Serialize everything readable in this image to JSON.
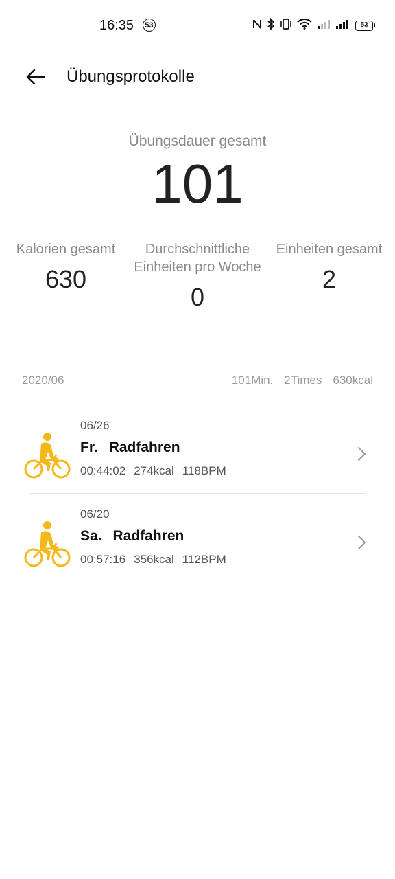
{
  "status_bar": {
    "time": "16:35",
    "badge": "53",
    "battery": "53",
    "icons": [
      "nfc-icon",
      "bluetooth-icon",
      "vibrate-icon",
      "wifi-icon",
      "signal-icon",
      "signal-icon"
    ]
  },
  "header": {
    "title": "Übungsprotokolle"
  },
  "summary": {
    "duration_label": "Übungsdauer gesamt",
    "duration_value": "101"
  },
  "stats": {
    "calories_label": "Kalorien gesamt",
    "calories_value": "630",
    "weekly_label": "Durchschnittliche Einheiten pro Woche",
    "weekly_value": "0",
    "units_label": "Einheiten gesamt",
    "units_value": "2"
  },
  "month": {
    "label": "2020/06",
    "minutes": "101Min.",
    "times": "2Times",
    "kcal": "630kcal"
  },
  "activities": [
    {
      "date": "06/26",
      "day": "Fr.",
      "type": "Radfahren",
      "duration": "00:44:02",
      "kcal": "274kcal",
      "bpm": "118BPM"
    },
    {
      "date": "06/20",
      "day": "Sa.",
      "type": "Radfahren",
      "duration": "00:57:16",
      "kcal": "356kcal",
      "bpm": "112BPM"
    }
  ],
  "colors": {
    "accent": "#F5B819",
    "muted_text": "#8a8a8a"
  }
}
